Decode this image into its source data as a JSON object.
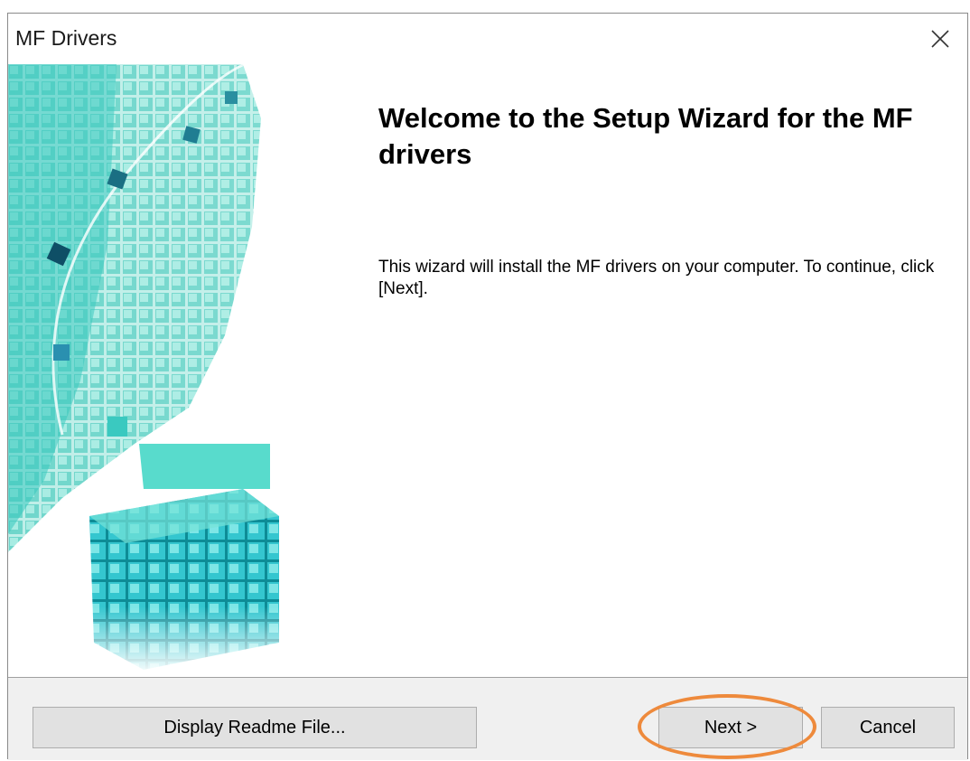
{
  "window": {
    "title": "MF Drivers",
    "close_icon": "close-icon"
  },
  "content": {
    "heading": "Welcome to the Setup Wizard for the MF drivers",
    "description": "This wizard will install the MF drivers on your computer. To continue, click [Next]."
  },
  "footer": {
    "readme_label": "Display Readme File...",
    "next_label": "Next >",
    "cancel_label": "Cancel"
  },
  "colors": {
    "accent_cubes": "#2ec8c0",
    "highlight_ring": "#ee8a3c",
    "footer_bg": "#f0f0f0"
  }
}
